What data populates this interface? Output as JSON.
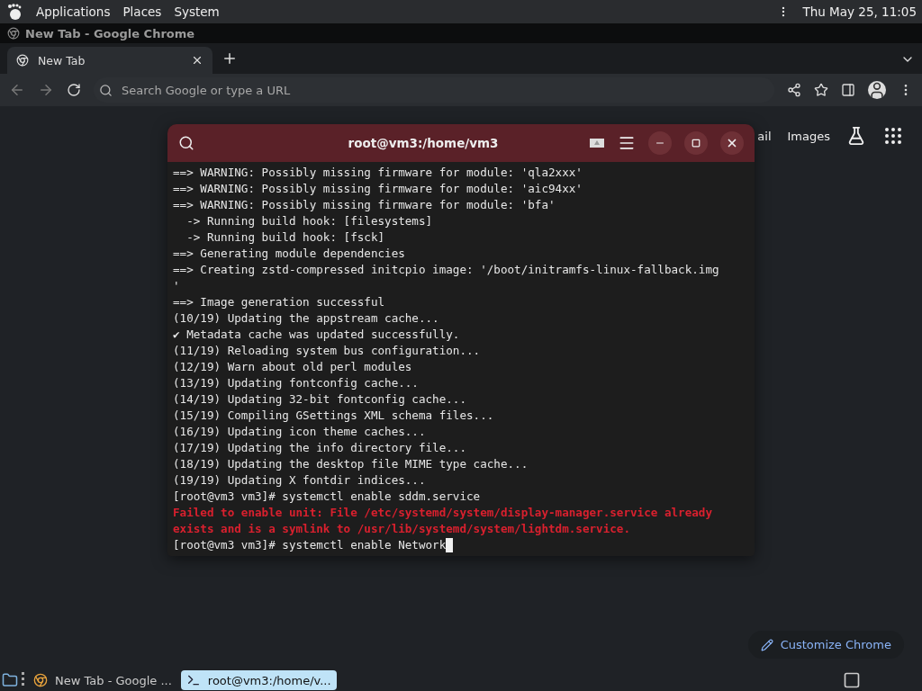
{
  "top_panel": {
    "menus": [
      "Applications",
      "Places",
      "System"
    ],
    "clock": "Thu May 25, 11:05"
  },
  "browser": {
    "window_title": "New Tab - Google Chrome",
    "tabs": [
      {
        "label": "New Tab",
        "selected": true
      }
    ],
    "omnibox": {
      "placeholder": "Search Google or type a URL"
    },
    "page": {
      "links": [
        "ail",
        "Images"
      ],
      "customize_button": "Customize Chrome"
    }
  },
  "terminal": {
    "title": "root@vm3:/home/vm3",
    "cursor": true,
    "lines": [
      {
        "kind": "normal",
        "text": "==> WARNING: Possibly missing firmware for module: 'qla2xxx'"
      },
      {
        "kind": "normal",
        "text": "==> WARNING: Possibly missing firmware for module: 'aic94xx'"
      },
      {
        "kind": "normal",
        "text": "==> WARNING: Possibly missing firmware for module: 'bfa'"
      },
      {
        "kind": "normal",
        "text": "  -> Running build hook: [filesystems]"
      },
      {
        "kind": "normal",
        "text": "  -> Running build hook: [fsck]"
      },
      {
        "kind": "normal",
        "text": "==> Generating module dependencies"
      },
      {
        "kind": "normal",
        "text": "==> Creating zstd-compressed initcpio image: '/boot/initramfs-linux-fallback.img"
      },
      {
        "kind": "normal",
        "text": "'"
      },
      {
        "kind": "normal",
        "text": "==> Image generation successful"
      },
      {
        "kind": "normal",
        "text": "(10/19) Updating the appstream cache..."
      },
      {
        "kind": "normal",
        "text": "✔ Metadata cache was updated successfully."
      },
      {
        "kind": "normal",
        "text": "(11/19) Reloading system bus configuration..."
      },
      {
        "kind": "normal",
        "text": "(12/19) Warn about old perl modules"
      },
      {
        "kind": "normal",
        "text": "(13/19) Updating fontconfig cache..."
      },
      {
        "kind": "normal",
        "text": "(14/19) Updating 32-bit fontconfig cache..."
      },
      {
        "kind": "normal",
        "text": "(15/19) Compiling GSettings XML schema files..."
      },
      {
        "kind": "normal",
        "text": "(16/19) Updating icon theme caches..."
      },
      {
        "kind": "normal",
        "text": "(17/19) Updating the info directory file..."
      },
      {
        "kind": "normal",
        "text": "(18/19) Updating the desktop file MIME type cache..."
      },
      {
        "kind": "normal",
        "text": "(19/19) Updating X fontdir indices..."
      },
      {
        "kind": "normal",
        "text": "[root@vm3 vm3]# systemctl enable sddm.service"
      },
      {
        "kind": "error",
        "text": "Failed to enable unit: File /etc/systemd/system/display-manager.service already"
      },
      {
        "kind": "error",
        "text": "exists and is a symlink to /usr/lib/systemd/system/lightdm.service."
      },
      {
        "kind": "normal",
        "text": "[root@vm3 vm3]# systemctl enable Network"
      }
    ]
  },
  "taskbar": {
    "items": [
      {
        "label": "New Tab - Google ...",
        "kind": "browser",
        "selected": false
      },
      {
        "label": "root@vm3:/home/v...",
        "kind": "terminal",
        "selected": true
      }
    ]
  }
}
